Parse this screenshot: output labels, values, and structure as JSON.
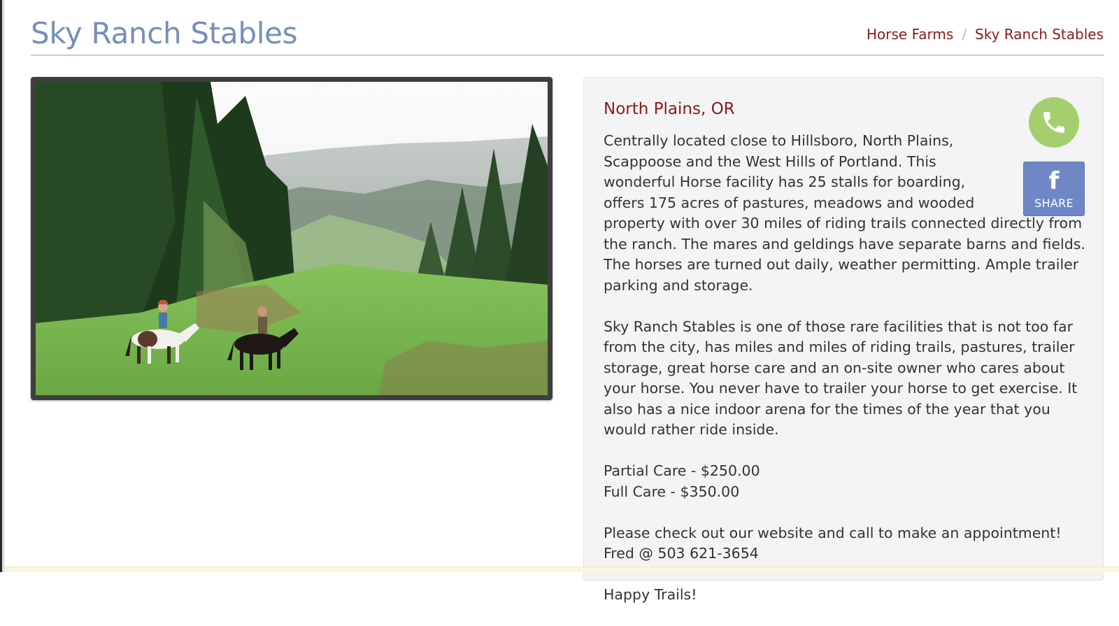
{
  "page": {
    "title": "Sky Ranch Stables"
  },
  "breadcrumb": {
    "items": [
      "Horse Farms",
      "Sky Ranch Stables"
    ],
    "separator": "/"
  },
  "photo": {
    "alt": "Two riders on horseback in a green meadow surrounded by evergreen trees"
  },
  "listing": {
    "location": "North Plains, OR",
    "description_1": "Centrally located close to Hillsboro, North Plains, Scappoose and the West Hills of Portland. This wonderful Horse facility has 25 stalls for boarding, offers 175 acres of pastures, meadows and wooded property with over 30 miles of riding trails connected directly from the ranch. The mares and geldings have separate barns and fields. The horses are turned out daily, weather permitting. Ample trailer parking and storage.",
    "description_2": "Sky Ranch Stables is one of those rare facilities that is not too far from the city, has miles and miles of riding trails, pastures, trailer storage, great horse care and an on-site owner who cares about your horse. You never have to trailer your horse to get exercise. It also has a nice indoor arena for the times of the year that you would rather ride inside.",
    "price_partial": "Partial Care - $250.00",
    "price_full": "Full Care - $350.00",
    "contact": "Please check out our website and call to make an appointment! Fred @ 503 621-3654",
    "closing": "Happy Trails!"
  },
  "actions": {
    "call_icon": "phone-icon",
    "share_icon": "facebook-icon",
    "share_label": "SHARE"
  },
  "colors": {
    "title": "#7590b5",
    "accent": "#8b1a1a",
    "call_button": "#a3cf6f",
    "share_button": "#6f88c5",
    "panel_bg": "#f4f4f4"
  }
}
